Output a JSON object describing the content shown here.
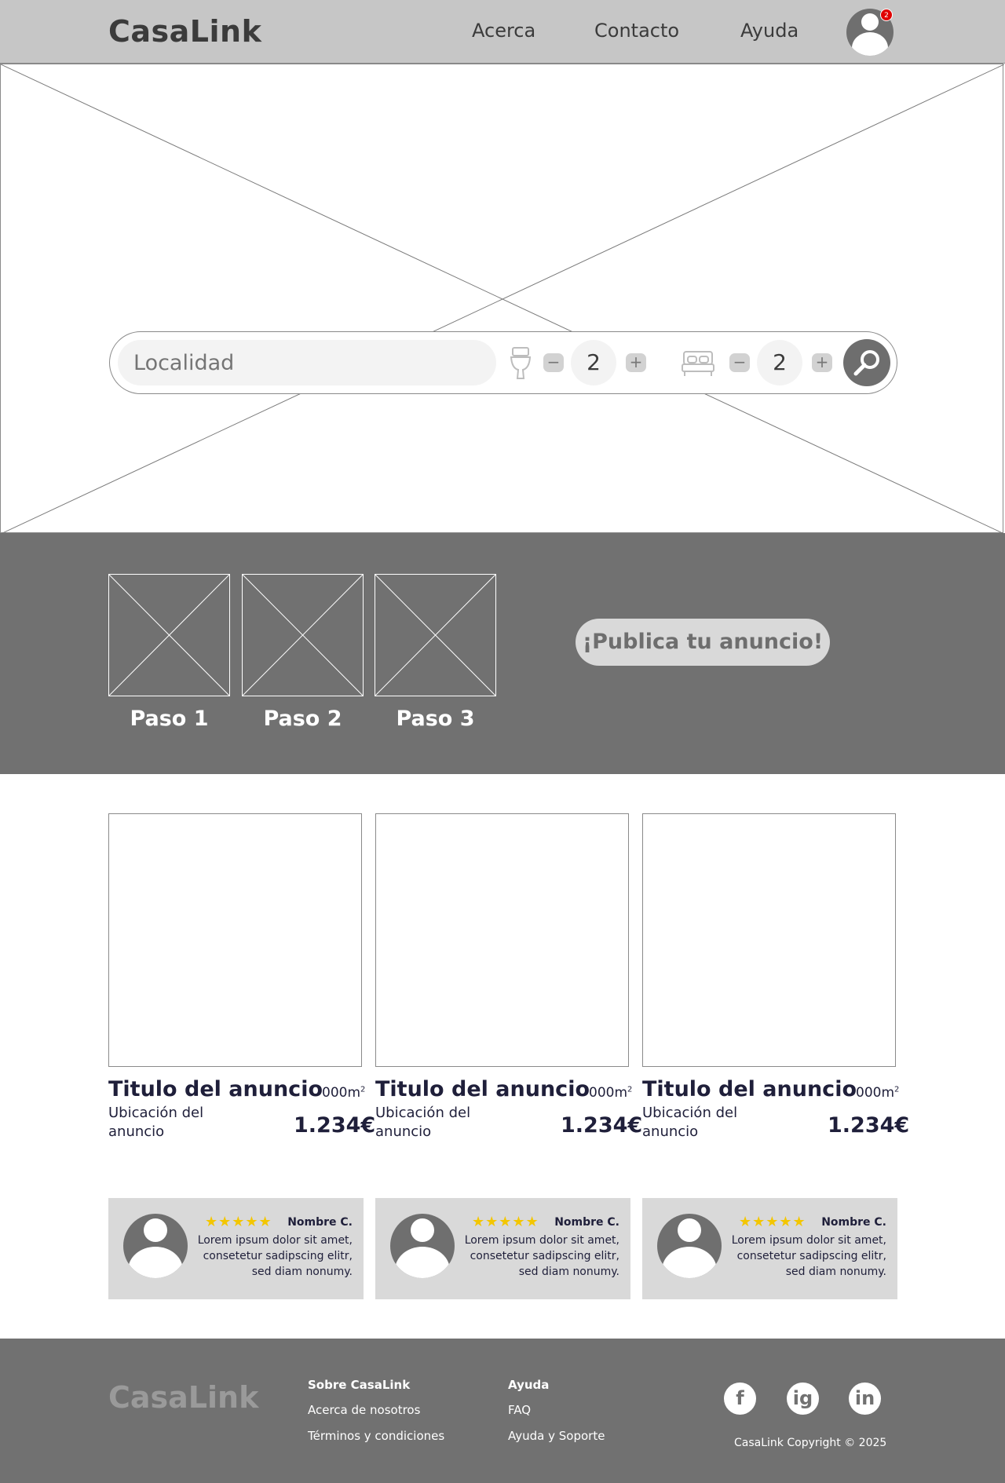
{
  "header": {
    "logo": "CasaLink",
    "nav": [
      "Acerca",
      "Contacto",
      "Ayuda"
    ],
    "notifications": "2"
  },
  "search": {
    "location_placeholder": "Localidad",
    "bathrooms": "2",
    "bedrooms": "2",
    "minus": "−",
    "plus": "+"
  },
  "steps": {
    "labels": [
      "Paso 1",
      "Paso 2",
      "Paso 3"
    ],
    "publish_label": "¡Publica tu anuncio!"
  },
  "listings": [
    {
      "title": "Titulo del anuncio",
      "area": "000m",
      "area_unit": "2",
      "location": "Ubicación del anuncio",
      "price": "1.234€"
    },
    {
      "title": "Titulo del anuncio",
      "area": "000m",
      "area_unit": "2",
      "location": "Ubicación del anuncio",
      "price": "1.234€"
    },
    {
      "title": "Titulo del anuncio",
      "area": "000m",
      "area_unit": "2",
      "location": "Ubicación del anuncio",
      "price": "1.234€"
    }
  ],
  "reviews": [
    {
      "stars": "★★★★★",
      "name": "Nombre C.",
      "text": "Lorem ipsum dolor sit amet, consetetur sadipscing elitr, sed diam nonumy."
    },
    {
      "stars": "★★★★★",
      "name": "Nombre C.",
      "text": "Lorem ipsum dolor sit amet, consetetur sadipscing elitr, sed diam nonumy."
    },
    {
      "stars": "★★★★★",
      "name": "Nombre C.",
      "text": "Lorem ipsum dolor sit amet, consetetur sadipscing elitr, sed diam nonumy."
    }
  ],
  "footer": {
    "logo": "CasaLink",
    "col1": {
      "heading": "Sobre CasaLink",
      "links": [
        "Acerca de nosotros",
        "Términos y condiciones"
      ]
    },
    "col2": {
      "heading": "Ayuda",
      "links": [
        "FAQ",
        "Ayuda y Soporte"
      ]
    },
    "social": [
      "f",
      "ig",
      "in"
    ],
    "copyright": "CasaLink Copyright © 2025"
  },
  "colors": {
    "header_bg": "#c6c6c6",
    "band_bg": "#717171",
    "card_bg": "#d9d9d9",
    "star": "#f3c600",
    "badge": "#e00000",
    "text_dark": "#1f1f3a"
  }
}
